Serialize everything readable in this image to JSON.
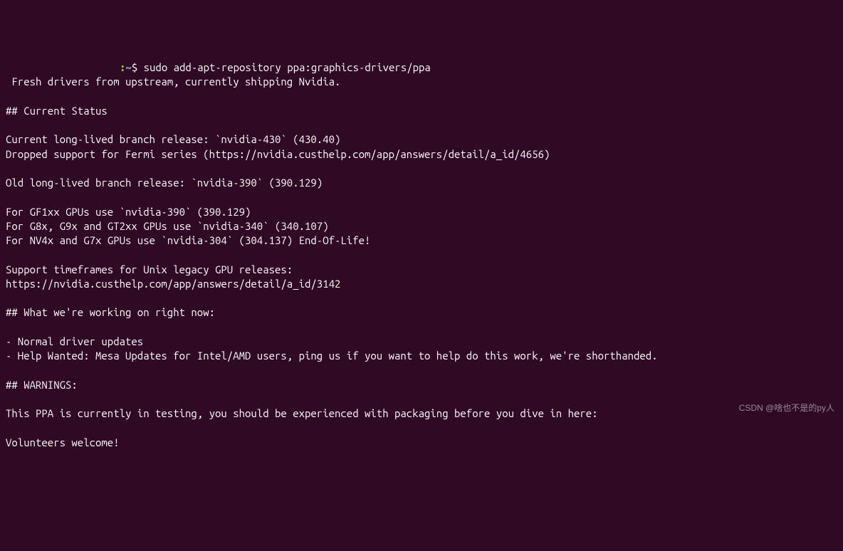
{
  "prompt": {
    "separator": ":",
    "path": "~",
    "dollar": "$ ",
    "command": "sudo add-apt-repository ppa:graphics-drivers/ppa"
  },
  "output": {
    "line1": " Fresh drivers from upstream, currently shipping Nvidia.",
    "blank1": "",
    "section1_header": "## Current Status",
    "blank2": "",
    "current_branch": "Current long-lived branch release: `nvidia-430` (430.40)",
    "dropped_support": "Dropped support for Fermi series (https://nvidia.custhelp.com/app/answers/detail/a_id/4656)",
    "blank3": "",
    "old_branch": "Old long-lived branch release: `nvidia-390` (390.129)",
    "blank4": "",
    "gf1xx": "For GF1xx GPUs use `nvidia-390` (390.129)",
    "g8x": "For G8x, G9x and GT2xx GPUs use `nvidia-340` (340.107)",
    "nv4x": "For NV4x and G7x GPUs use `nvidia-304` (304.137) End-Of-Life!",
    "blank5": "",
    "support_timeframes": "Support timeframes for Unix legacy GPU releases:",
    "support_url": "https://nvidia.custhelp.com/app/answers/detail/a_id/3142",
    "blank6": "",
    "section2_header": "## What we're working on right now:",
    "blank7": "",
    "working1": "- Normal driver updates",
    "working2": "- Help Wanted: Mesa Updates for Intel/AMD users, ping us if you want to help do this work, we're shorthanded.",
    "blank8": "",
    "section3_header": "## WARNINGS:",
    "blank9": "",
    "warning_text": "This PPA is currently in testing, you should be experienced with packaging before you dive in here:",
    "blank10": "",
    "volunteers": "Volunteers welcome!"
  },
  "watermark": "CSDN @啥也不是的py人"
}
